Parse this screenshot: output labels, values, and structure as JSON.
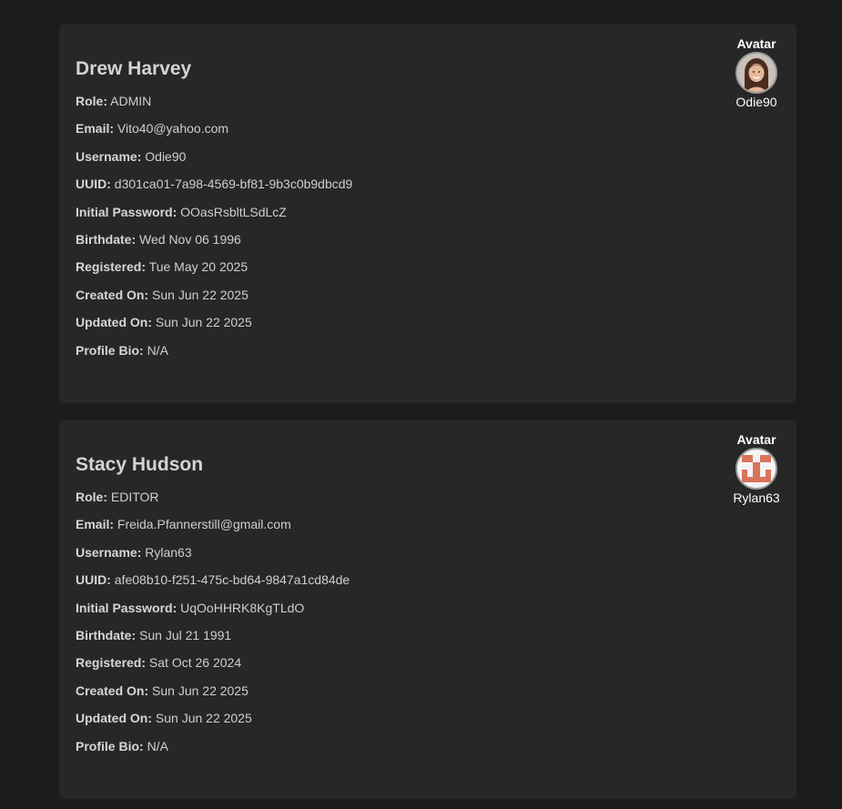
{
  "users": [
    {
      "name": "Drew Harvey",
      "avatar_title": "Avatar",
      "avatar_username": "Odie90",
      "avatar_kind": "photo-portrait",
      "fields": [
        {
          "label": "Role:",
          "value": "ADMIN"
        },
        {
          "label": "Email:",
          "value": "Vito40@yahoo.com"
        },
        {
          "label": "Username:",
          "value": "Odie90"
        },
        {
          "label": "UUID:",
          "value": "d301ca01-7a98-4569-bf81-9b3c0b9dbcd9"
        },
        {
          "label": "Initial Password:",
          "value": "OOasRsbltLSdLcZ"
        },
        {
          "label": "Birthdate:",
          "value": "Wed Nov 06 1996"
        },
        {
          "label": "Registered:",
          "value": "Tue May 20 2025"
        },
        {
          "label": "Created On:",
          "value": "Sun Jun 22 2025"
        },
        {
          "label": "Updated On:",
          "value": "Sun Jun 22 2025"
        },
        {
          "label": "Profile Bio:",
          "value": "N/A"
        }
      ]
    },
    {
      "name": "Stacy Hudson",
      "avatar_title": "Avatar",
      "avatar_username": "Rylan63",
      "avatar_kind": "identicon",
      "avatar_color": "#d9745a",
      "fields": [
        {
          "label": "Role:",
          "value": "EDITOR"
        },
        {
          "label": "Email:",
          "value": "Freida.Pfannerstill@gmail.com"
        },
        {
          "label": "Username:",
          "value": "Rylan63"
        },
        {
          "label": "UUID:",
          "value": "afe08b10-f251-475c-bd64-9847a1cd84de"
        },
        {
          "label": "Initial Password:",
          "value": "UqOoHHRK8KgTLdO"
        },
        {
          "label": "Birthdate:",
          "value": "Sun Jul 21 1991"
        },
        {
          "label": "Registered:",
          "value": "Sat Oct 26 2024"
        },
        {
          "label": "Created On:",
          "value": "Sun Jun 22 2025"
        },
        {
          "label": "Updated On:",
          "value": "Sun Jun 22 2025"
        },
        {
          "label": "Profile Bio:",
          "value": "N/A"
        }
      ]
    }
  ]
}
